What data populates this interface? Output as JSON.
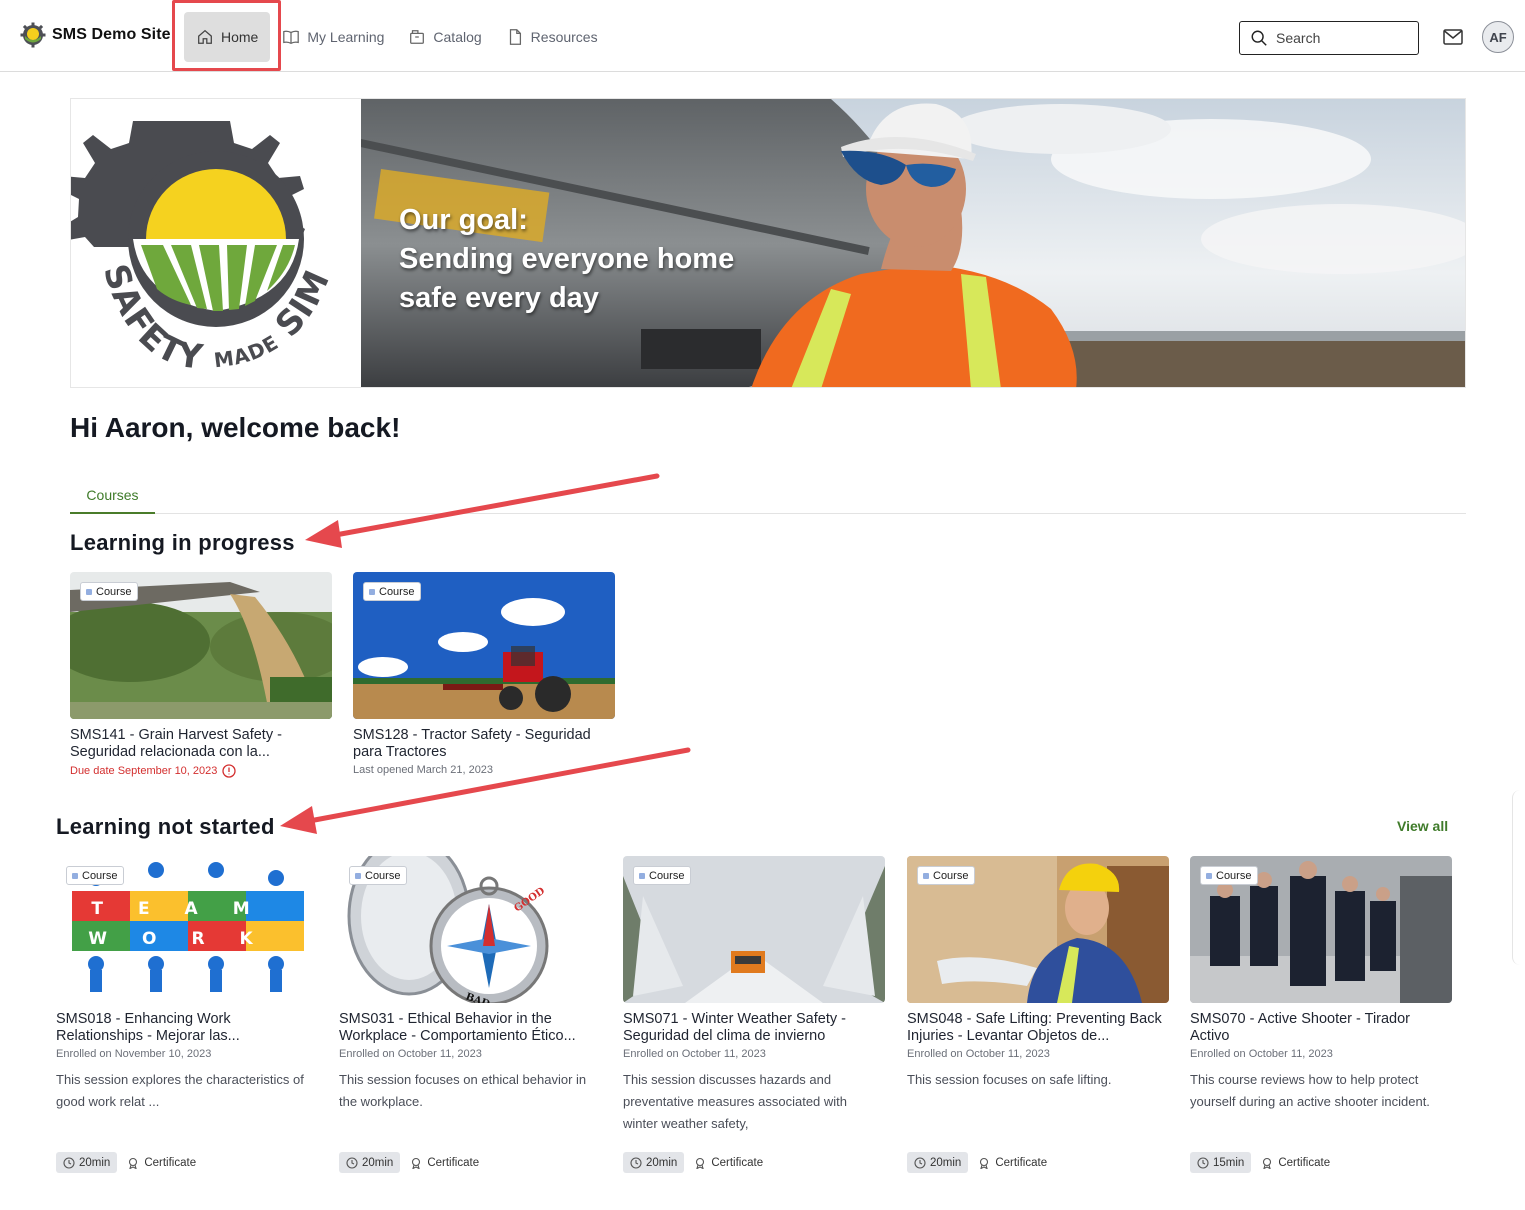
{
  "header": {
    "site_name": "SMS Demo Site",
    "nav": [
      {
        "label": "Home",
        "icon": "home-icon",
        "active": true
      },
      {
        "label": "My Learning",
        "icon": "book-icon",
        "active": false
      },
      {
        "label": "Catalog",
        "icon": "catalog-icon",
        "active": false
      },
      {
        "label": "Resources",
        "icon": "document-icon",
        "active": false
      }
    ],
    "search_placeholder": "Search",
    "avatar_initials": "AF",
    "highlight_color": "#e5484d"
  },
  "banner": {
    "logo_text_1": "SAFETY",
    "logo_text_2": "MADE",
    "logo_text_3": "SIMPLE",
    "slogan": [
      "Our goal:",
      "Sending everyone home",
      "safe every day"
    ]
  },
  "greeting": "Hi Aaron, welcome back!",
  "tabs": [
    "Courses"
  ],
  "in_progress": {
    "title": "Learning in progress",
    "items": [
      {
        "badge": "Course",
        "title": "SMS141 - Grain Harvest Safety - Seguridad relacionada con la...",
        "meta": "Due date September 10, 2023",
        "overdue": true
      },
      {
        "badge": "Course",
        "title": "SMS128 - Tractor Safety - Seguridad para Tractores",
        "meta": "Last opened March 21, 2023",
        "overdue": false
      }
    ]
  },
  "not_started": {
    "title": "Learning not started",
    "view_all": "View all",
    "items": [
      {
        "badge": "Course",
        "title": "SMS018 - Enhancing Work Relationships - Mejorar las...",
        "meta": "Enrolled on November 10, 2023",
        "desc": "This session explores the characteristics of good work relat ...",
        "duration": "20min",
        "cert": "Certificate",
        "thumb_word_1": "TEAM",
        "thumb_word_2": "WORK"
      },
      {
        "badge": "Course",
        "title": "SMS031 - Ethical Behavior in the Workplace - Comportamiento Ético...",
        "meta": "Enrolled on October 11, 2023",
        "desc": "This session focuses on ethical behavior in the workplace.",
        "duration": "20min",
        "cert": "Certificate",
        "thumb_word_1": "GOOD",
        "thumb_word_2": "BAD"
      },
      {
        "badge": "Course",
        "title": "SMS071 - Winter Weather Safety - Seguridad del clima de invierno",
        "meta": "Enrolled on October 11, 2023",
        "desc": "This session discusses hazards and preventative measures associated with winter weather safety,",
        "duration": "20min",
        "cert": "Certificate"
      },
      {
        "badge": "Course",
        "title": "SMS048 - Safe Lifting: Preventing Back Injuries - Levantar Objetos de...",
        "meta": "Enrolled on October 11, 2023",
        "desc": "This session focuses on safe lifting.",
        "duration": "20min",
        "cert": "Certificate"
      },
      {
        "badge": "Course",
        "title": "SMS070 - Active Shooter - Tirador Activo",
        "meta": "Enrolled on October 11, 2023",
        "desc": "This course reviews how to help protect yourself during an active shooter incident.",
        "duration": "15min",
        "cert": "Certificate"
      }
    ]
  },
  "colors": {
    "accent_green": "#3f7b2a",
    "overdue_red": "#d32f2f",
    "annotation_arrow": "#e5484d"
  }
}
